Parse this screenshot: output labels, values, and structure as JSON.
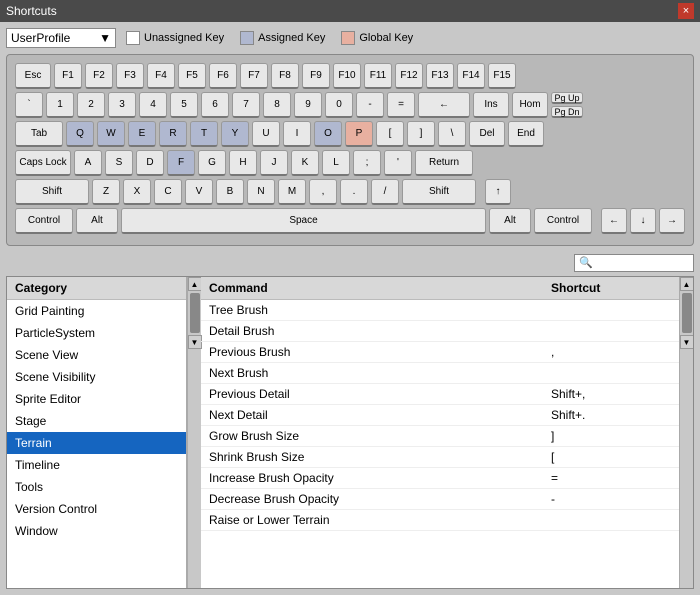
{
  "titleBar": {
    "title": "Shortcuts",
    "closeLabel": "×"
  },
  "profile": {
    "label": "UserProfile",
    "dropdownSymbol": "▼"
  },
  "legend": {
    "unassigned": "Unassigned Key",
    "assigned": "Assigned Key",
    "global": "Global Key"
  },
  "search": {
    "placeholder": "🔍"
  },
  "keyboard": {
    "rows": [
      [
        "Esc",
        "F1",
        "F2",
        "F3",
        "F4",
        "F5",
        "F6",
        "F7",
        "F8",
        "F9",
        "F10",
        "F11",
        "F12",
        "F13",
        "F14",
        "F15"
      ],
      [
        "`",
        "1",
        "2",
        "3",
        "4",
        "5",
        "6",
        "7",
        "8",
        "9",
        "0",
        "-",
        "=",
        "←"
      ],
      [
        "Tab",
        "Q",
        "W",
        "E",
        "R",
        "T",
        "Y",
        "U",
        "I",
        "O",
        "P",
        "[",
        "]",
        "\\"
      ],
      [
        "Caps Lock",
        "A",
        "S",
        "D",
        "F",
        "G",
        "H",
        "J",
        "K",
        "L",
        ";",
        "'",
        "Return"
      ],
      [
        "Shift",
        "Z",
        "X",
        "C",
        "V",
        "B",
        "N",
        "M",
        ",",
        ".",
        "/",
        "Shift"
      ],
      [
        "Control",
        "Alt",
        "Space",
        "Alt",
        "Control"
      ]
    ]
  },
  "categories": {
    "header": "Category",
    "items": [
      "Grid Painting",
      "ParticleSystem",
      "Scene View",
      "Scene Visibility",
      "Sprite Editor",
      "Stage",
      "Terrain",
      "Timeline",
      "Tools",
      "Version Control",
      "Window"
    ],
    "selected": "Terrain"
  },
  "commands": {
    "commandHeader": "Command",
    "shortcutHeader": "Shortcut",
    "items": [
      {
        "command": "Tree Brush",
        "shortcut": ""
      },
      {
        "command": "Detail Brush",
        "shortcut": ""
      },
      {
        "command": "Previous Brush",
        "shortcut": ","
      },
      {
        "command": "Next Brush",
        "shortcut": ""
      },
      {
        "command": "Previous Detail",
        "shortcut": "Shift+,"
      },
      {
        "command": "Next Detail",
        "shortcut": "Shift+."
      },
      {
        "command": "Grow Brush Size",
        "shortcut": "]"
      },
      {
        "command": "Shrink Brush Size",
        "shortcut": "["
      },
      {
        "command": "Increase Brush Opacity",
        "shortcut": "="
      },
      {
        "command": "Decrease Brush Opacity",
        "shortcut": "-"
      },
      {
        "command": "Raise or Lower Terrain",
        "shortcut": ""
      }
    ]
  },
  "colors": {
    "selectedCategory": "#1565c0",
    "highlightedKey": "#b0b8d0",
    "globalKey": "#e8b0a0"
  }
}
